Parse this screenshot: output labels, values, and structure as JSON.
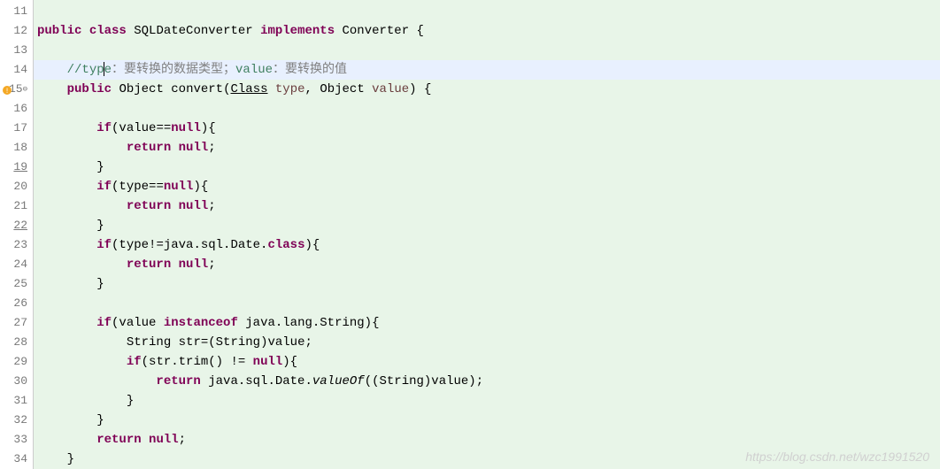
{
  "gutter": {
    "lines": [
      {
        "num": "11",
        "underlined": false,
        "marker": null
      },
      {
        "num": "12",
        "underlined": false,
        "marker": null
      },
      {
        "num": "13",
        "underlined": false,
        "marker": null
      },
      {
        "num": "14",
        "underlined": false,
        "marker": null
      },
      {
        "num": "15",
        "underlined": false,
        "marker": "warning"
      },
      {
        "num": "16",
        "underlined": false,
        "marker": null
      },
      {
        "num": "17",
        "underlined": false,
        "marker": null
      },
      {
        "num": "18",
        "underlined": false,
        "marker": null
      },
      {
        "num": "19",
        "underlined": true,
        "marker": null
      },
      {
        "num": "20",
        "underlined": false,
        "marker": null
      },
      {
        "num": "21",
        "underlined": false,
        "marker": null
      },
      {
        "num": "22",
        "underlined": true,
        "marker": null
      },
      {
        "num": "23",
        "underlined": false,
        "marker": null
      },
      {
        "num": "24",
        "underlined": false,
        "marker": null
      },
      {
        "num": "25",
        "underlined": false,
        "marker": null
      },
      {
        "num": "26",
        "underlined": false,
        "marker": null
      },
      {
        "num": "27",
        "underlined": false,
        "marker": null
      },
      {
        "num": "28",
        "underlined": false,
        "marker": null
      },
      {
        "num": "29",
        "underlined": false,
        "marker": null
      },
      {
        "num": "30",
        "underlined": false,
        "marker": null
      },
      {
        "num": "31",
        "underlined": false,
        "marker": null
      },
      {
        "num": "32",
        "underlined": false,
        "marker": null
      },
      {
        "num": "33",
        "underlined": false,
        "marker": null
      },
      {
        "num": "34",
        "underlined": false,
        "marker": null
      }
    ]
  },
  "code": {
    "l11": "   ",
    "l12_kw1": "public",
    "l12_kw2": "class",
    "l12_cls": "SQLDateConverter",
    "l12_kw3": "implements",
    "l12_impl": "Converter {",
    "l14_c1": "//typ",
    "l14_c2": "e",
    "l14_cn": "：要转换的数据类型；",
    "l14_c3": "value",
    "l14_cn2": "：要转换的值",
    "l15_kw": "public",
    "l15_t1": "Object",
    "l15_m": "convert(",
    "l15_t2": "Class",
    "l15_p1": "type",
    "l15_t3": "Object",
    "l15_p2": "value",
    "l15_end": ") {",
    "l17_kw": "if",
    "l17_rest": "(value==",
    "l17_null": "null",
    "l17_end": "){",
    "l18_kw": "return",
    "l18_null": "null",
    "l18_end": ";",
    "l19": "        }",
    "l20_kw": "if",
    "l20_rest": "(type==",
    "l20_null": "null",
    "l20_end": "){",
    "l21_kw": "return",
    "l21_null": "null",
    "l21_end": ";",
    "l22": "        }",
    "l23_kw": "if",
    "l23_rest": "(type!=java.sql.Date.",
    "l23_cls": "class",
    "l23_end": "){",
    "l24_kw": "return",
    "l24_null": "null",
    "l24_end": ";",
    "l25": "        }",
    "l27_kw": "if",
    "l27_rest": "(value ",
    "l27_inst": "instanceof",
    "l27_end": " java.lang.String){",
    "l28_t": "String",
    "l28_rest": " str=(String)value;",
    "l29_kw": "if",
    "l29_rest": "(str.trim() != ",
    "l29_null": "null",
    "l29_end": "){",
    "l30_kw": "return",
    "l30_rest": " java.sql.Date.",
    "l30_m": "valueOf",
    "l30_end": "((String)value);",
    "l31": "            }",
    "l32": "        }",
    "l33_kw": "return",
    "l33_null": "null",
    "l33_end": ";",
    "l34": "    }"
  },
  "watermark": "https://blog.csdn.net/wzc1991520"
}
